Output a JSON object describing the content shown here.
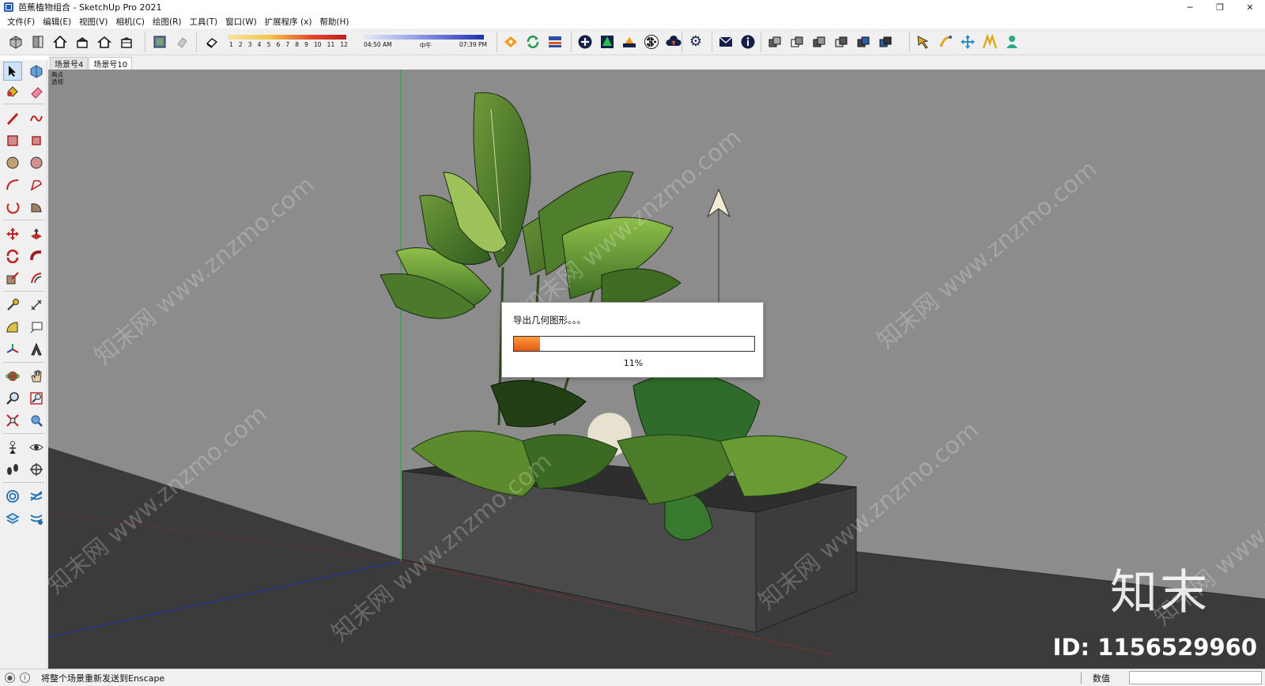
{
  "window": {
    "title": "芭蕉植物组合 - SketchUp Pro 2021",
    "app_icon": "sketchup-icon",
    "controls": [
      "minimize-icon",
      "restore-icon",
      "close-icon"
    ]
  },
  "menu": [
    {
      "label": "文件(F)"
    },
    {
      "label": "编辑(E)"
    },
    {
      "label": "视图(V)"
    },
    {
      "label": "相机(C)"
    },
    {
      "label": "绘图(R)"
    },
    {
      "label": "工具(T)"
    },
    {
      "label": "窗口(W)"
    },
    {
      "label": "扩展程序 (x)"
    },
    {
      "label": "帮助(H)"
    }
  ],
  "toolbar": {
    "shadow_months": [
      "1",
      "2",
      "3",
      "4",
      "5",
      "6",
      "7",
      "8",
      "9",
      "10",
      "11",
      "12"
    ],
    "time_start": "04:50 AM",
    "time_mid": "中午",
    "time_end": "07:39 PM",
    "icons": [
      "views-iso-icon",
      "views-top-icon",
      "views-front-icon",
      "views-right-icon",
      "views-back-icon",
      "views-left-icon",
      "texture-icon",
      "shadow-icon",
      "eraser-style-icon",
      "enscape-start-icon",
      "enscape-sync-icon",
      "enscape-views-icon",
      "add-icon",
      "tree-icon",
      "material-icon",
      "checker-icon",
      "cloud-upload-icon",
      "settings-icon",
      "feedback-icon",
      "info-icon",
      "component-icon",
      "layers-1-icon",
      "layers-2-icon",
      "layers-3-icon",
      "layers-4-icon",
      "layers-5-icon",
      "pointer-icon",
      "walk-icon",
      "move-icon",
      "scale-icon",
      "person-icon"
    ],
    "accent": "#f0f0f0"
  },
  "left_tools": {
    "icons": [
      "select-icon",
      "component-icon",
      "paint-bucket-icon",
      "eraser-icon",
      "line-icon",
      "freehand-icon",
      "rectangle-icon",
      "rotated-rectangle-icon",
      "circle-icon",
      "polygon-icon",
      "arc-icon",
      "two-point-arc-icon",
      "three-point-arc-icon",
      "pie-icon",
      "move-icon",
      "push-pull-icon",
      "rotate-icon",
      "follow-me-icon",
      "scale-icon",
      "offset-icon",
      "tape-measure-icon",
      "dimension-icon",
      "protractor-icon",
      "text-icon",
      "axes-icon",
      "3d-text-icon",
      "orbit-icon",
      "pan-icon",
      "zoom-icon",
      "zoom-window-icon",
      "zoom-extents-icon",
      "previous-view-icon",
      "position-camera-icon",
      "look-around-icon",
      "walk-icon",
      "section-plane-icon",
      "sandbox-1-icon",
      "sandbox-2-icon",
      "sandbox-3-icon",
      "sandbox-4-icon"
    ]
  },
  "scene_tabs": [
    {
      "label": "场景号4",
      "active": false
    },
    {
      "label": "场景号10",
      "active": true
    }
  ],
  "viewport": {
    "camera_label_1": "两点",
    "camera_label_2": "透视",
    "watermark_text": "知末网 www.znzmo.com",
    "brand_text": "知末",
    "id_text": "ID: 1156529960"
  },
  "dialog": {
    "message": "导出几何图形。。。",
    "percent_text": "11%",
    "progress": 0.11,
    "fill_color": "#f07a22"
  },
  "status": {
    "message": "将整个场景重新发送到Enscape",
    "vcb_label": "数值",
    "vcb_value": ""
  }
}
